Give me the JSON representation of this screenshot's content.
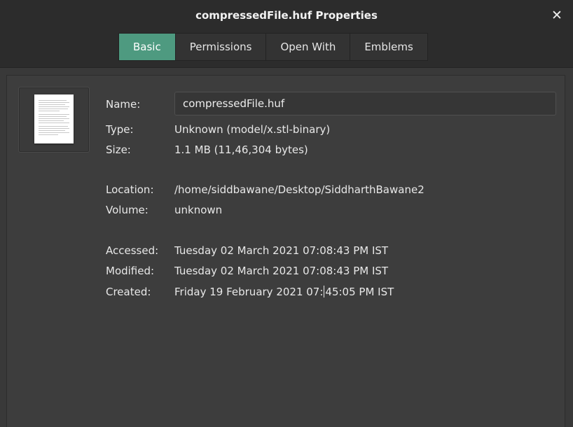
{
  "window": {
    "title": "compressedFile.huf Properties",
    "close_label": "✕"
  },
  "tabs": [
    {
      "label": "Basic",
      "active": true
    },
    {
      "label": "Permissions",
      "active": false
    },
    {
      "label": "Open With",
      "active": false
    },
    {
      "label": "Emblems",
      "active": false
    }
  ],
  "properties": {
    "name_label": "Name:",
    "name_value": "compressedFile.huf",
    "type_label": "Type:",
    "type_value": "Unknown (model/x.stl-binary)",
    "size_label": "Size:",
    "size_value": "1.1 MB (11,46,304 bytes)",
    "location_label": "Location:",
    "location_value": "/home/siddbawane/Desktop/SiddharthBawane2",
    "volume_label": "Volume:",
    "volume_value": "unknown",
    "accessed_label": "Accessed:",
    "accessed_value": "Tuesday 02 March 2021 07:08:43 PM IST",
    "modified_label": "Modified:",
    "modified_value": "Tuesday 02 March 2021 07:08:43 PM IST",
    "created_label": "Created:",
    "created_value_part1": "Friday 19 February 2021 07:",
    "created_value_part2": "45:05 PM IST"
  },
  "icons": {
    "file_icon": "document-icon",
    "close_icon": "close-icon"
  },
  "colors": {
    "active_tab": "#4e9a80",
    "background": "#3d3d3d",
    "titlebar": "#2c2c2c"
  }
}
